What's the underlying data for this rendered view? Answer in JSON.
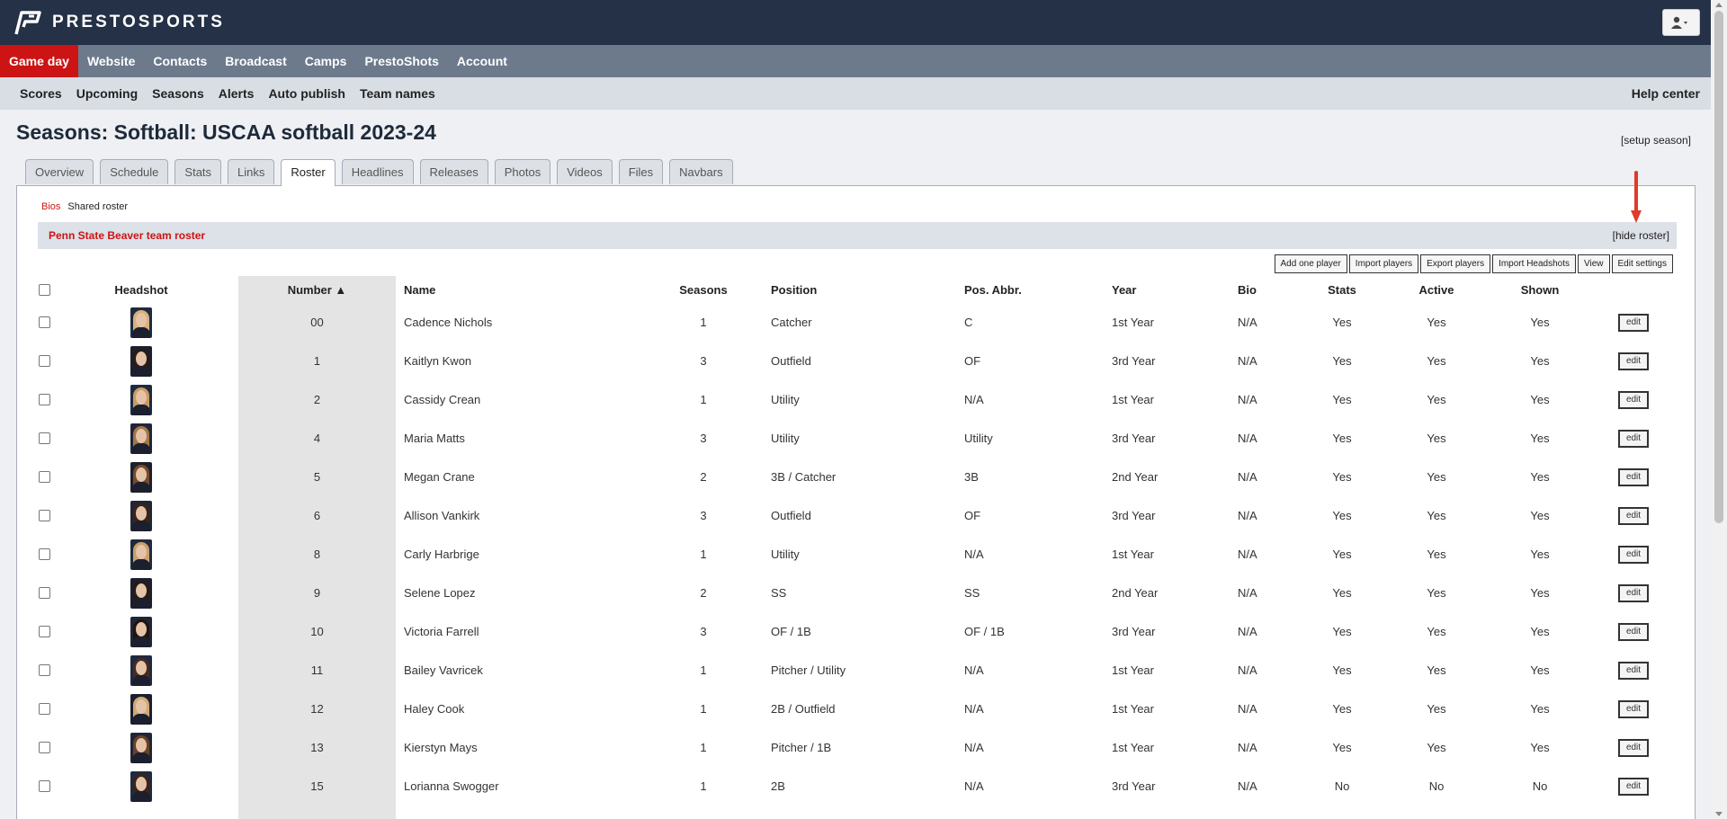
{
  "brand": {
    "name": "PRESTOSPORTS"
  },
  "main_nav": [
    "Game day",
    "Website",
    "Contacts",
    "Broadcast",
    "Camps",
    "PrestoShots",
    "Account"
  ],
  "sub_nav": [
    "Scores",
    "Upcoming",
    "Seasons",
    "Alerts",
    "Auto publish",
    "Team names"
  ],
  "help_center": "Help center",
  "page_title": "Seasons: Softball: USCAA softball 2023-24",
  "setup_link": "[setup season]",
  "tabs": [
    "Overview",
    "Schedule",
    "Stats",
    "Links",
    "Roster",
    "Headlines",
    "Releases",
    "Photos",
    "Videos",
    "Files",
    "Navbars"
  ],
  "active_tab": "Roster",
  "roster_links": {
    "bios": "Bios",
    "shared": "Shared roster"
  },
  "roster_title": "Penn State Beaver team roster",
  "hide_roster": "[hide roster]",
  "actions": [
    "Add one player",
    "Import players",
    "Export players",
    "Import Headshots",
    "View",
    "Edit settings"
  ],
  "columns": {
    "headshot": "Headshot",
    "number": "Number ▲",
    "name": "Name",
    "seasons": "Seasons",
    "position": "Position",
    "pos_abbr": "Pos. Abbr.",
    "year": "Year",
    "bio": "Bio",
    "stats": "Stats",
    "active": "Active",
    "shown": "Shown"
  },
  "edit_label": "edit",
  "colors": {
    "brand_dark": "#243147",
    "accent_red": "#cc1414",
    "nav_gray": "#6c7a8c"
  },
  "players": [
    {
      "number": "00",
      "name": "Cadence Nichols",
      "seasons": "1",
      "position": "Catcher",
      "pos_abbr": "C",
      "year": "1st Year",
      "bio": "N/A",
      "stats": "Yes",
      "active": "Yes",
      "shown": "Yes"
    },
    {
      "number": "1",
      "name": "Kaitlyn Kwon",
      "seasons": "3",
      "position": "Outfield",
      "pos_abbr": "OF",
      "year": "3rd Year",
      "bio": "N/A",
      "stats": "Yes",
      "active": "Yes",
      "shown": "Yes"
    },
    {
      "number": "2",
      "name": "Cassidy Crean",
      "seasons": "1",
      "position": "Utility",
      "pos_abbr": "N/A",
      "year": "1st Year",
      "bio": "N/A",
      "stats": "Yes",
      "active": "Yes",
      "shown": "Yes"
    },
    {
      "number": "4",
      "name": "Maria Matts",
      "seasons": "3",
      "position": "Utility",
      "pos_abbr": "Utility",
      "year": "3rd Year",
      "bio": "N/A",
      "stats": "Yes",
      "active": "Yes",
      "shown": "Yes"
    },
    {
      "number": "5",
      "name": "Megan Crane",
      "seasons": "2",
      "position": "3B / Catcher",
      "pos_abbr": "3B",
      "year": "2nd Year",
      "bio": "N/A",
      "stats": "Yes",
      "active": "Yes",
      "shown": "Yes"
    },
    {
      "number": "6",
      "name": "Allison Vankirk",
      "seasons": "3",
      "position": "Outfield",
      "pos_abbr": "OF",
      "year": "3rd Year",
      "bio": "N/A",
      "stats": "Yes",
      "active": "Yes",
      "shown": "Yes"
    },
    {
      "number": "8",
      "name": "Carly Harbrige",
      "seasons": "1",
      "position": "Utility",
      "pos_abbr": "N/A",
      "year": "1st Year",
      "bio": "N/A",
      "stats": "Yes",
      "active": "Yes",
      "shown": "Yes"
    },
    {
      "number": "9",
      "name": "Selene Lopez",
      "seasons": "2",
      "position": "SS",
      "pos_abbr": "SS",
      "year": "2nd Year",
      "bio": "N/A",
      "stats": "Yes",
      "active": "Yes",
      "shown": "Yes"
    },
    {
      "number": "10",
      "name": "Victoria Farrell",
      "seasons": "3",
      "position": "OF / 1B",
      "pos_abbr": "OF / 1B",
      "year": "3rd Year",
      "bio": "N/A",
      "stats": "Yes",
      "active": "Yes",
      "shown": "Yes"
    },
    {
      "number": "11",
      "name": "Bailey Vavricek",
      "seasons": "1",
      "position": "Pitcher / Utility",
      "pos_abbr": "N/A",
      "year": "1st Year",
      "bio": "N/A",
      "stats": "Yes",
      "active": "Yes",
      "shown": "Yes"
    },
    {
      "number": "12",
      "name": "Haley Cook",
      "seasons": "1",
      "position": "2B / Outfield",
      "pos_abbr": "N/A",
      "year": "1st Year",
      "bio": "N/A",
      "stats": "Yes",
      "active": "Yes",
      "shown": "Yes"
    },
    {
      "number": "13",
      "name": "Kierstyn Mays",
      "seasons": "1",
      "position": "Pitcher / 1B",
      "pos_abbr": "N/A",
      "year": "1st Year",
      "bio": "N/A",
      "stats": "Yes",
      "active": "Yes",
      "shown": "Yes"
    },
    {
      "number": "15",
      "name": "Lorianna Swogger",
      "seasons": "1",
      "position": "2B",
      "pos_abbr": "N/A",
      "year": "3rd Year",
      "bio": "N/A",
      "stats": "No",
      "active": "No",
      "shown": "No"
    }
  ]
}
